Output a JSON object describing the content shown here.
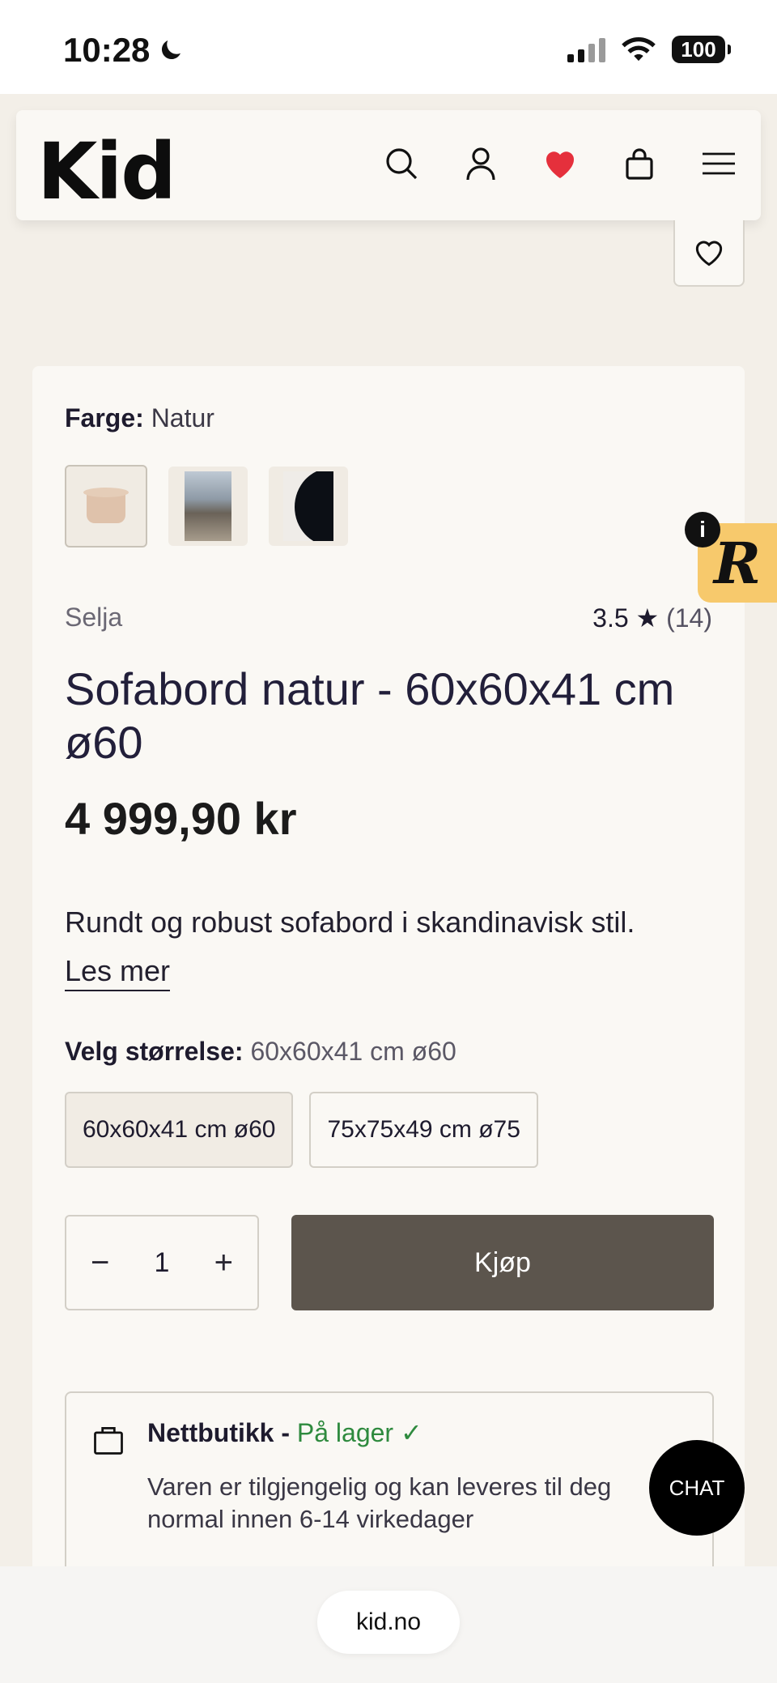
{
  "status_bar": {
    "time": "10:28",
    "battery": "100",
    "icons": [
      "moon-icon",
      "signal-icon",
      "wifi-icon",
      "battery-icon"
    ]
  },
  "header": {
    "logo": "Kid",
    "icons": [
      "search-icon",
      "user-icon",
      "heart-icon",
      "bag-icon",
      "menu-icon"
    ],
    "heart_color": "#e5303c"
  },
  "product": {
    "color_label": "Farge:",
    "color_value": "Natur",
    "brand": "Selja",
    "rating": "3.5",
    "rating_star": "★",
    "review_count": "(14)",
    "title": "Sofabord natur - 60x60x41 cm ø60",
    "price": "4 999,90 kr",
    "description": "Rundt og robust sofabord i skandinavisk stil.",
    "read_more": "Les mer",
    "size_label": "Velg størrelse:",
    "size_value": "60x60x41 cm ø60",
    "size_options": [
      "60x60x41 cm ø60",
      "75x75x49 cm ø75"
    ],
    "quantity": "1",
    "qty_minus": "−",
    "qty_plus": "+",
    "buy_label": "Kjøp"
  },
  "stock": {
    "title": "Nettbutikk - ",
    "status": "På lager ✓",
    "status_color": "#2e8a3e",
    "text": "Varen er tilgjengelig og kan leveres til deg normal innen 6-14 virkedager"
  },
  "floating": {
    "info": "i",
    "badge": "R",
    "chat": "CHAT"
  },
  "browser": {
    "url": "kid.no"
  },
  "colors": {
    "buy_button": "#5c554d",
    "background": "#f3efe8",
    "card": "#faf8f4",
    "badge": "#f7c96c"
  }
}
